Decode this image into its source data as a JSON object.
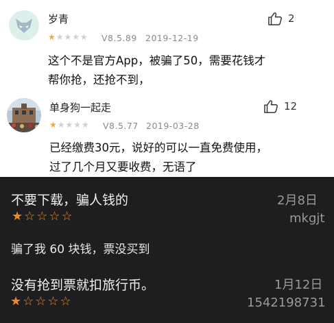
{
  "light_reviews": [
    {
      "username": "岁青",
      "rating": 1,
      "version": "V8.5.89",
      "date": "2019-12-19",
      "likes": "2",
      "body_lines": [
        "这个不是官方App，被骗了50，需要花钱才",
        "帮你抢，还抢不到，"
      ]
    },
    {
      "username": "单身狗一起走",
      "rating": 1,
      "version": "V8.5.77",
      "date": "2019-03-28",
      "likes": "12",
      "body_lines": [
        "已经缴费30元，说好的可以一直免费使用，",
        "过了几个月又要收费，无语了"
      ]
    }
  ],
  "dark_reviews": [
    {
      "title": "不要下载，骗人钱的",
      "date": "2月8日",
      "rating": 1,
      "user": "mkgjt",
      "body": "骗了我 60 块钱，票没买到"
    },
    {
      "title": "没有抢到票就扣旅行币。",
      "date": "1月12日",
      "rating": 1,
      "user": "1542198731"
    }
  ],
  "colors": {
    "star_light": "#f2a735",
    "star_dark": "#f08a24",
    "dark_bg": "#1e1e1e"
  },
  "icons": [
    "thumbs-up-icon",
    "star-icon"
  ]
}
